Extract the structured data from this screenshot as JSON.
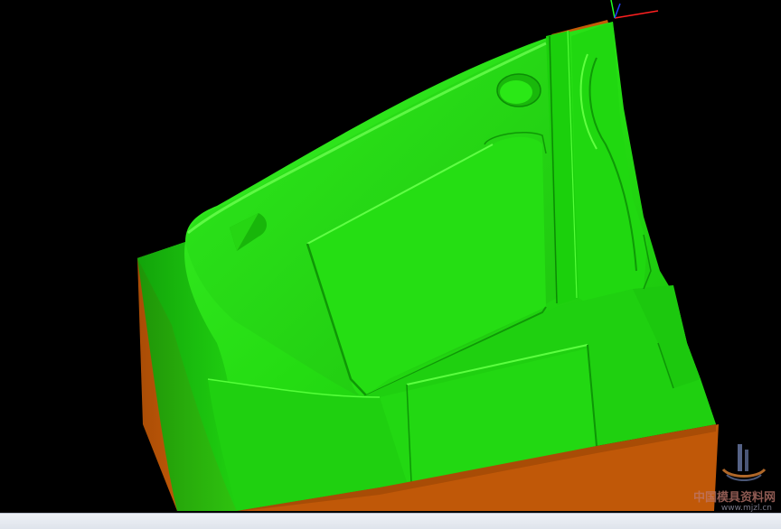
{
  "watermark": {
    "title": "中国模具资料网",
    "url": "www.mjzl.cn"
  },
  "colors": {
    "background": "#000000",
    "model_green": "#22e010",
    "model_orange": "#c25a08",
    "axis_x": "#ff2020",
    "axis_y": "#20ff20",
    "axis_z": "#2040ff"
  }
}
